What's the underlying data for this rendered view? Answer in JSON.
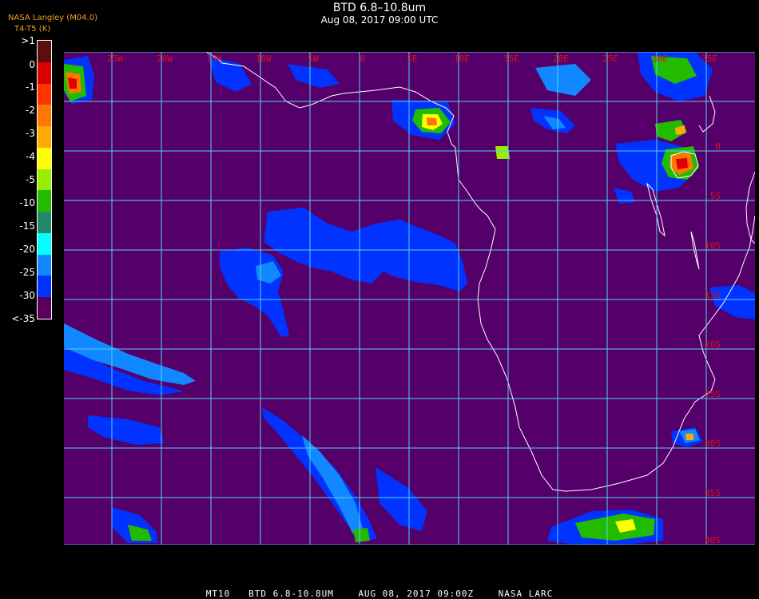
{
  "header": {
    "title": "BTD 6.8–10.8um",
    "timestamp": "Aug 08, 2017 09:00 UTC",
    "source": "NASA Langley (M04.0)",
    "units": "T4-T5 (K)"
  },
  "legend": {
    "labels": [
      ">1",
      "0",
      "-1",
      "-2",
      "-3",
      "-4",
      "-5",
      "-10",
      "-15",
      "-20",
      "-25",
      "-30",
      "<-35"
    ],
    "colors": [
      "#5e0d0d",
      "#dd0000",
      "#ff3300",
      "#ff7700",
      "#ffaa00",
      "#ffff00",
      "#99ee00",
      "#22bb00",
      "#228866",
      "#00ffff",
      "#1188ff",
      "#0033ff",
      "#5a005a"
    ]
  },
  "map": {
    "background_color": "#55006a",
    "grid_color": "#4fd6f0",
    "label_color": "#dd1111",
    "lon_labels": [
      "25W",
      "20W",
      "15W",
      "10W",
      "5W",
      "0",
      "5E",
      "10E",
      "15E",
      "20E",
      "25E",
      "30E",
      "35E"
    ],
    "lat_labels": [
      "0",
      "5S",
      "10S",
      "15S",
      "20S",
      "25S",
      "30S",
      "35S",
      "40S"
    ]
  },
  "footer": "MT10   BTD 6.8-10.8UM    AUG 08, 2017 09:00Z    NASA LARC"
}
